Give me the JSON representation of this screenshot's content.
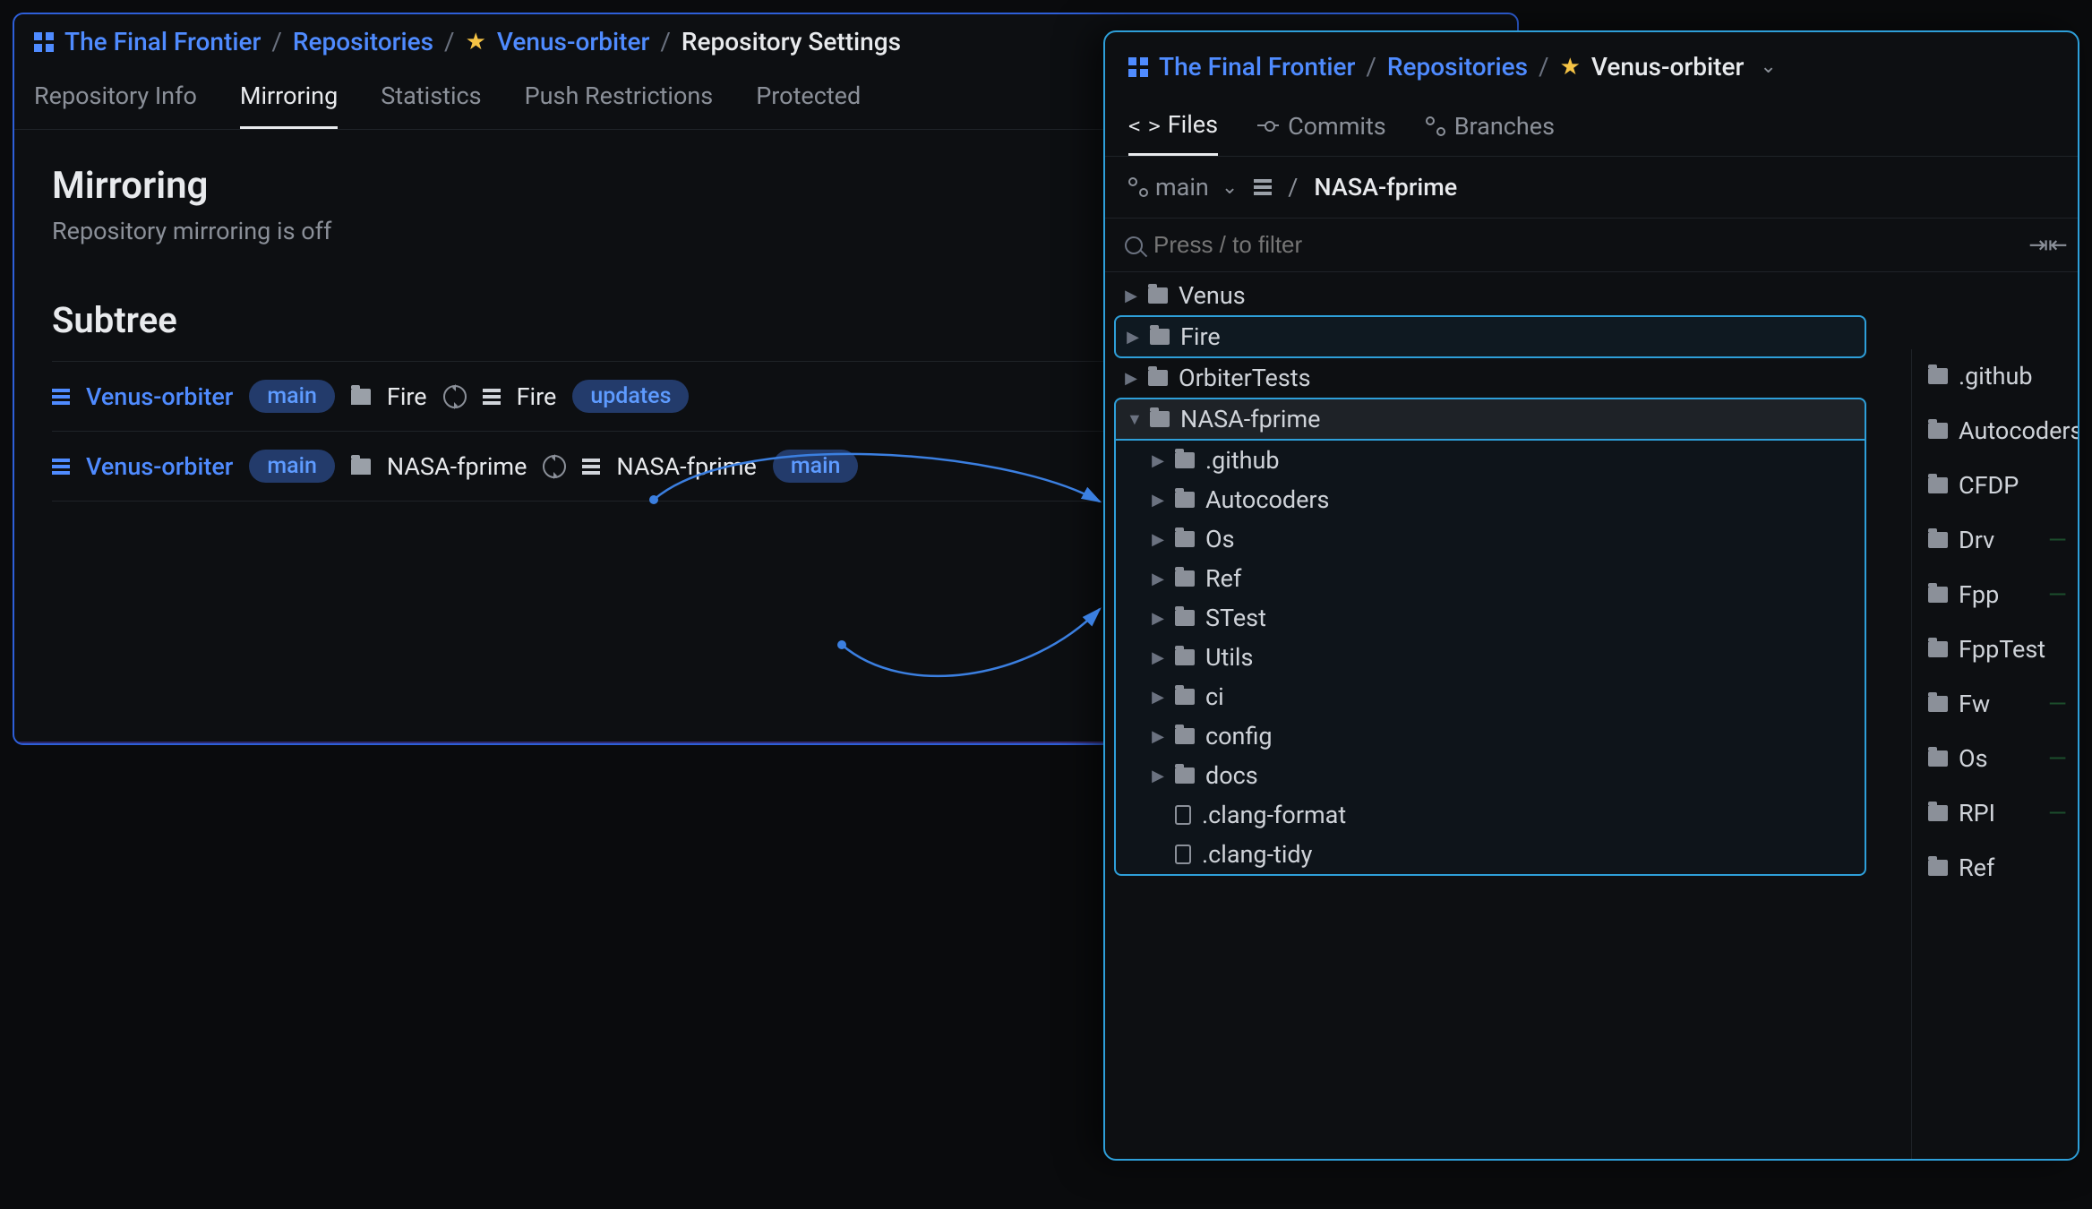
{
  "left": {
    "breadcrumbs": {
      "project": "The Final Frontier",
      "repos": "Repositories",
      "repo": "Venus-orbiter",
      "page": "Repository Settings"
    },
    "tabs": [
      "Repository Info",
      "Mirroring",
      "Statistics",
      "Push Restrictions",
      "Protected"
    ],
    "active_tab": "Mirroring",
    "mirroring": {
      "title": "Mirroring",
      "subtitle": "Repository mirroring is off"
    },
    "subtree": {
      "title": "Subtree",
      "rows": [
        {
          "src_repo": "Venus-orbiter",
          "src_branch": "main",
          "src_path": "Fire",
          "dst_repo": "Fire",
          "dst_branch": "updates"
        },
        {
          "src_repo": "Venus-orbiter",
          "src_branch": "main",
          "src_path": "NASA-fprime",
          "dst_repo": "NASA-fprime",
          "dst_branch": "main"
        }
      ]
    }
  },
  "right": {
    "breadcrumbs": {
      "project": "The Final Frontier",
      "repos": "Repositories",
      "repo": "Venus-orbiter"
    },
    "tabs": {
      "files": "Files",
      "commits": "Commits",
      "branches": "Branches"
    },
    "branch": "main",
    "path_root": "/",
    "path_current": "NASA-fprime",
    "filter_placeholder": "Press / to filter",
    "tree": {
      "top": [
        {
          "name": "Venus",
          "hl": false
        },
        {
          "name": "Fire",
          "hl": true
        },
        {
          "name": "OrbiterTests",
          "hl": false
        }
      ],
      "nasa": {
        "name": "NASA-fprime",
        "children_folders": [
          ".github",
          "Autocoders",
          "Os",
          "Ref",
          "STest",
          "Utils",
          "ci",
          "config",
          "docs"
        ],
        "children_files": [
          ".clang-format",
          ".clang-tidy"
        ]
      }
    },
    "right_list": [
      ".github",
      "Autocoders",
      "CFDP",
      "Drv",
      "Fpp",
      "FppTest",
      "Fw",
      "Os",
      "RPI",
      "Ref"
    ]
  }
}
